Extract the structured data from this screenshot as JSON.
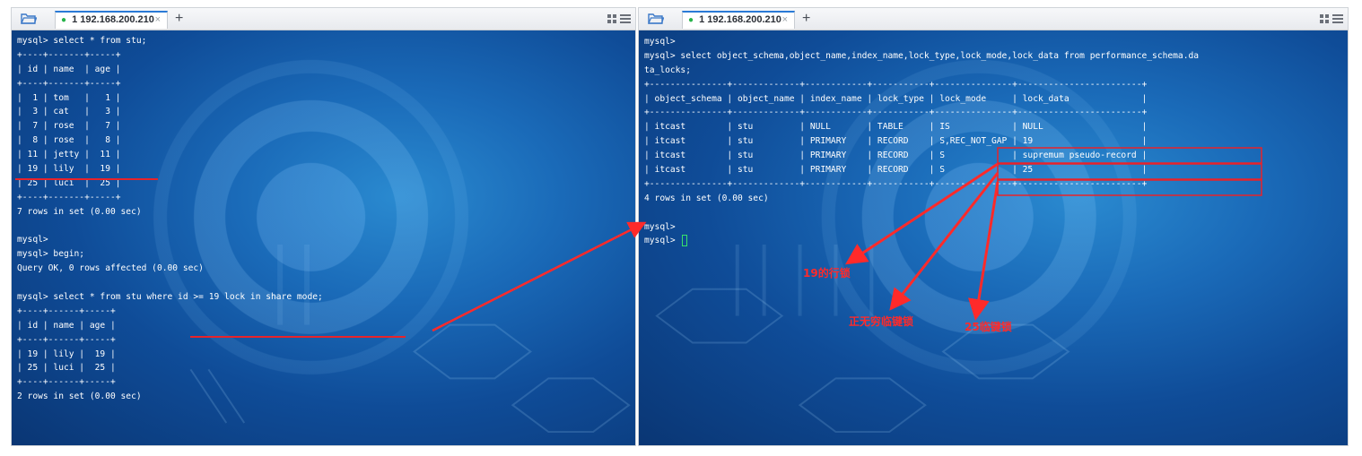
{
  "left_pane": {
    "tab_number": "1",
    "tab_label": "192.168.200.210",
    "close_symbol": "×",
    "plus_symbol": "+",
    "lines": [
      "mysql> select * from stu;",
      "+----+-------+-----+",
      "| id | name  | age |",
      "+----+-------+-----+",
      "|  1 | tom   |   1 |",
      "|  3 | cat   |   3 |",
      "|  7 | rose  |   7 |",
      "|  8 | rose  |   8 |",
      "| 11 | jetty |  11 |",
      "| 19 | lily  |  19 |",
      "| 25 | luci  |  25 |",
      "+----+-------+-----+",
      "7 rows in set (0.00 sec)",
      "",
      "mysql>",
      "mysql> begin;",
      "Query OK, 0 rows affected (0.00 sec)",
      "",
      "mysql> select * from stu where id >= 19 lock in share mode;",
      "+----+------+-----+",
      "| id | name | age |",
      "+----+------+-----+",
      "| 19 | lily |  19 |",
      "| 25 | luci |  25 |",
      "+----+------+-----+",
      "2 rows in set (0.00 sec)"
    ]
  },
  "right_pane": {
    "tab_number": "1",
    "tab_label": "192.168.200.210",
    "close_symbol": "×",
    "plus_symbol": "+",
    "lines": [
      "mysql>",
      "mysql> select object_schema,object_name,index_name,lock_type,lock_mode,lock_data from performance_schema.da",
      "ta_locks;",
      "+---------------+-------------+------------+-----------+---------------+------------------------+",
      "| object_schema | object_name | index_name | lock_type | lock_mode     | lock_data              |",
      "+---------------+-------------+------------+-----------+---------------+------------------------+",
      "| itcast        | stu         | NULL       | TABLE     | IS            | NULL                   |",
      "| itcast        | stu         | PRIMARY    | RECORD    | S,REC_NOT_GAP | 19                     |",
      "| itcast        | stu         | PRIMARY    | RECORD    | S             | supremum pseudo-record |",
      "| itcast        | stu         | PRIMARY    | RECORD    | S             | 25                     |",
      "+---------------+-------------+------------+-----------+---------------+------------------------+",
      "4 rows in set (0.00 sec)",
      "",
      "mysql>",
      "mysql> "
    ]
  },
  "annotations": {
    "label_19": "19的行锁",
    "label_supremum": "正无穷临键锁",
    "label_25": "25临键锁"
  },
  "colors": {
    "annotation": "#ff2a2a",
    "cursor": "#37e36b",
    "tab_dot": "#27b34a",
    "terminal_text": "#ffffff"
  },
  "icons": {
    "folder": "folder-icon",
    "layout": "layout-grid-icon",
    "close": "close-icon",
    "add_tab": "plus-icon"
  }
}
